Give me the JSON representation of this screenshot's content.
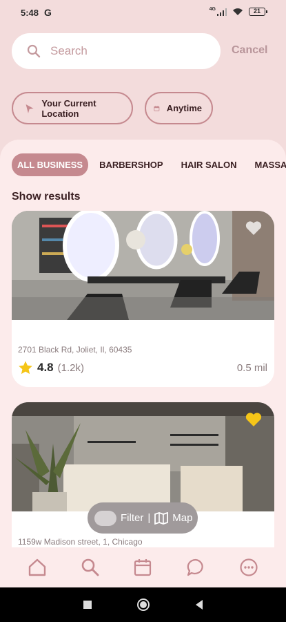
{
  "status": {
    "time": "5:48",
    "carrier_icon": "G",
    "network": "4G",
    "battery": "21"
  },
  "search": {
    "placeholder": "Search",
    "value": "",
    "cancel_label": "Cancel"
  },
  "chips": {
    "location": "Your Current Location",
    "time": "Anytime"
  },
  "categories": [
    "ALL BUSINESS",
    "BARBERSHOP",
    "HAIR SALON",
    "MASSAGE PA"
  ],
  "results_title": "Show results",
  "listings": [
    {
      "address": "2701 Black Rd, Joliet, Il, 60435",
      "rating": "4.8",
      "review_count": "(1.2k)",
      "distance": "0.5 mil",
      "favorited": false
    },
    {
      "address": "1159w Madison street, 1, Chicago",
      "favorited": true
    }
  ],
  "filter": {
    "filter_label": "Filter",
    "separator": "|",
    "map_label": "Map"
  },
  "nav": [
    "home-icon",
    "search-icon",
    "calendar-icon",
    "chat-icon",
    "more-icon"
  ],
  "colors": {
    "accent": "#c5898f",
    "background": "#f3dcdc",
    "panel": "#fcebeb",
    "star": "#f5c518",
    "favorite": "#f5c518"
  }
}
